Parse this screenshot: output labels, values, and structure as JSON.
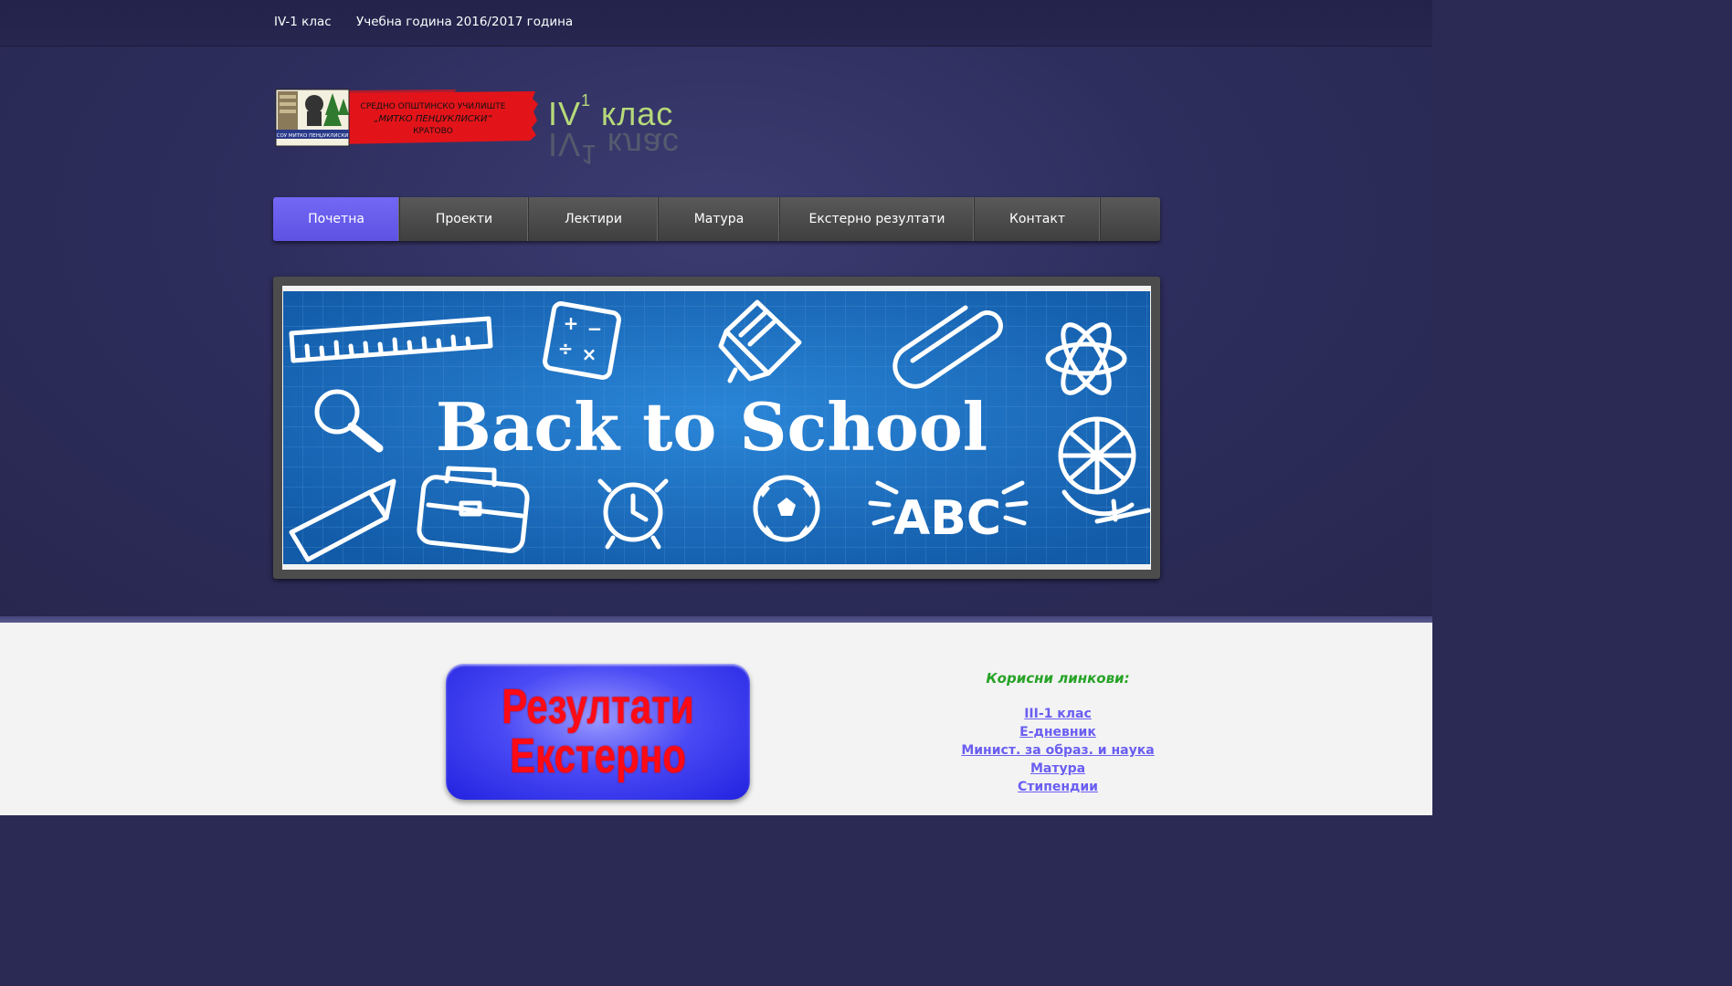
{
  "topbar": {
    "class_label": "IV-1 клас",
    "year_label": "Учебна година 2016/2017 година"
  },
  "header": {
    "logo": {
      "line1": "СРЕДНО ОПШТИНСКО УЧИЛИШТЕ",
      "line2": "„МИТКО ПЕНЏУКЛИСКИ“",
      "line3": "КРАТОВО",
      "badge": "СОУ МИТКО ПЕНЏУКЛИСКИ"
    },
    "title_main": "IV",
    "title_sup": "1",
    "title_rest": " клас"
  },
  "nav": {
    "items": [
      {
        "label": "Почетна",
        "active": true
      },
      {
        "label": "Проекти"
      },
      {
        "label": "Лектири"
      },
      {
        "label": "Матура"
      },
      {
        "label": "Екстерно резултати"
      },
      {
        "label": "Контакт"
      }
    ]
  },
  "banner": {
    "text": "Back to School",
    "abc": "ABC",
    "calc_plus": "+",
    "calc_minus": "−",
    "calc_div": "÷",
    "calc_times": "×"
  },
  "content": {
    "results_button": {
      "line1": "Резултати",
      "line2": "Екстерно"
    },
    "links_title": "Корисни линкови:",
    "links": [
      "III-1 клас",
      "Е-дневник",
      "Минист. за образ. и наука",
      "Матура",
      "Стипендии"
    ]
  },
  "colors": {
    "header_bg": "#2e2e5e",
    "nav_active": "#6a5ef2",
    "title_green": "#b6d979",
    "banner_blue": "#1a6fc4",
    "links_title": "#27a327",
    "link": "#6a5ef2",
    "results_text": "#ff0a14"
  }
}
